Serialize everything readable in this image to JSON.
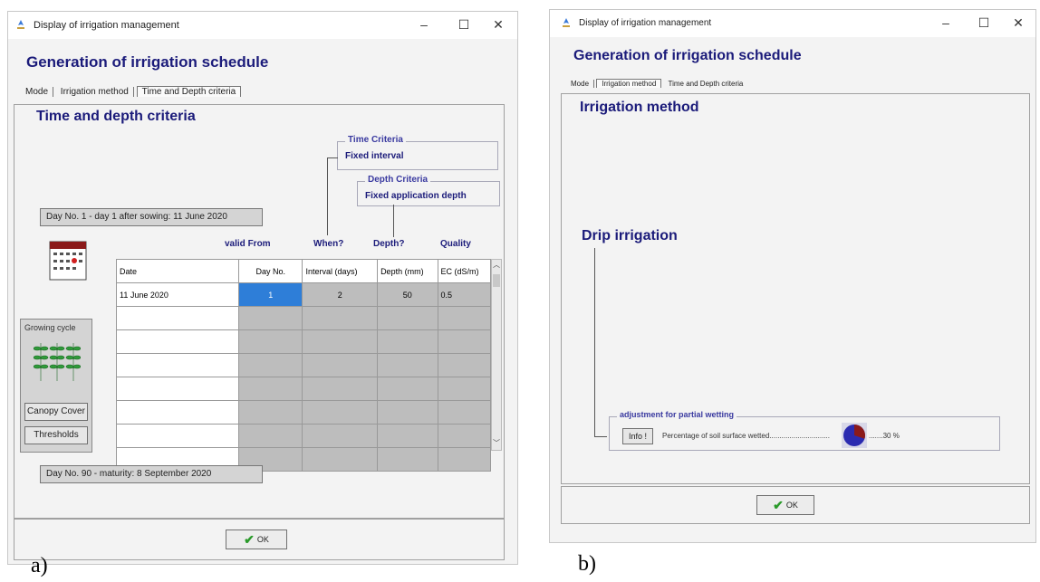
{
  "left": {
    "window_title": "Display of irrigation management",
    "heading": "Generation of irrigation schedule",
    "tabs": [
      "Mode",
      "Irrigation method",
      "Time and Depth criteria"
    ],
    "section_title": "Time and depth criteria",
    "time_criteria": {
      "legend": "Time Criteria",
      "value": "Fixed interval"
    },
    "depth_criteria": {
      "legend": "Depth Criteria",
      "value": "Fixed application depth"
    },
    "start_banner": "Day No. 1 - day 1 after sowing: 11 June 2020",
    "end_banner": "Day No. 90 - maturity: 8 September 2020",
    "column_headers_top": {
      "valid_from": "valid From",
      "when": "When?",
      "depth": "Depth?",
      "quality": "Quality"
    },
    "table_headers": [
      "Date",
      "Day No.",
      "Interval (days)",
      "Depth (mm)",
      "EC (dS/m)"
    ],
    "rows": [
      {
        "date": "11 June 2020",
        "day": "1",
        "interval": "2",
        "depth": "50",
        "ec": "0.5"
      }
    ],
    "growing_cycle_label": "Growing cycle",
    "canopy_cover_button": "Canopy Cover",
    "thresholds_button": "Thresholds",
    "ok_button": "OK",
    "caption": "a)"
  },
  "right": {
    "window_title": "Display of irrigation management",
    "heading": "Generation of irrigation schedule",
    "tabs": [
      "Mode",
      "Irrigation method",
      "Time and Depth criteria"
    ],
    "section_title": "Irrigation method",
    "method": "Drip irrigation",
    "partial_wetting": {
      "legend": "adjustment for partial wetting",
      "info_button": "Info !",
      "label": "Percentage of soil surface wetted",
      "value": "30",
      "unit": "%",
      "fraction": 0.3
    },
    "ok_button": "OK",
    "caption": "b)"
  },
  "colors": {
    "heading": "#1b1b7a",
    "selected_cell": "#2e7ed8",
    "pie_fill": "#8b1a1a",
    "pie_bg": "#2b2bb0"
  }
}
